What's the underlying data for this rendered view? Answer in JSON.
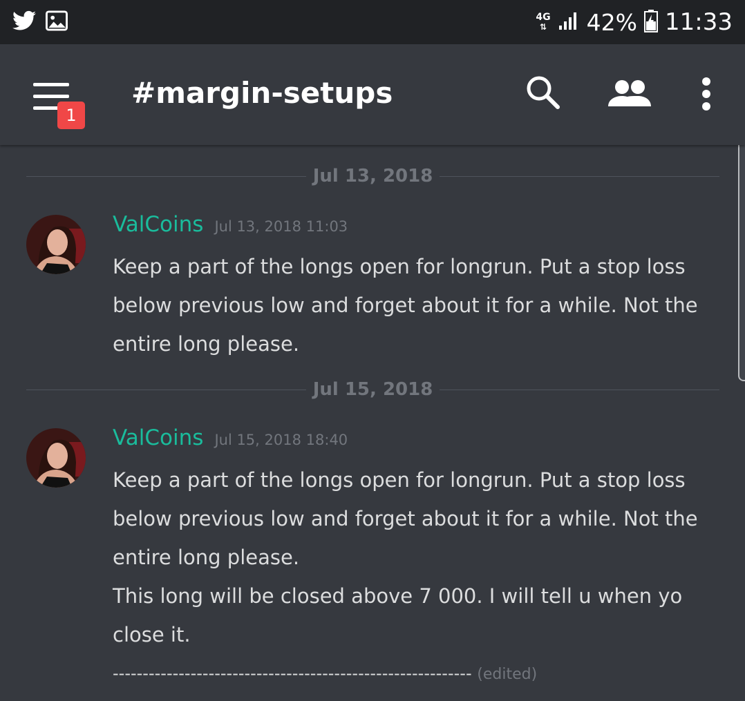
{
  "status_bar": {
    "network": "4G",
    "battery": "42%",
    "time": "11:33",
    "left_icons": [
      "twitter-icon",
      "image-icon"
    ]
  },
  "app_bar": {
    "channel": "#margin-setups",
    "badge_count": "1",
    "icons": [
      "menu-icon",
      "search-icon",
      "members-icon",
      "more-vert-icon"
    ]
  },
  "messages": [
    {
      "date_divider": "Jul 13, 2018",
      "author": "ValCoins",
      "timestamp": "Jul 13, 2018 11:03",
      "lines": [
        "Keep a part of the longs open for longrun. Put a stop loss",
        "below previous low and forget about it for a while. Not the",
        "entire long please."
      ]
    },
    {
      "date_divider": "Jul 15, 2018",
      "author": "ValCoins",
      "timestamp": "Jul 15, 2018 18:40",
      "lines": [
        "Keep a part of the longs open for longrun. Put a stop loss",
        "below previous low and forget about it for a while. Not the",
        "entire long please.",
        "This long will be closed above 7 000. I will tell u when yo",
        "close it.",
        "------------------------------------------------------------"
      ],
      "edited_label": "(edited)"
    }
  ],
  "colors": {
    "background": "#36393f",
    "status_bar": "#202225",
    "username": "#1abc9c",
    "badge": "#f04747",
    "muted": "#72767d"
  }
}
